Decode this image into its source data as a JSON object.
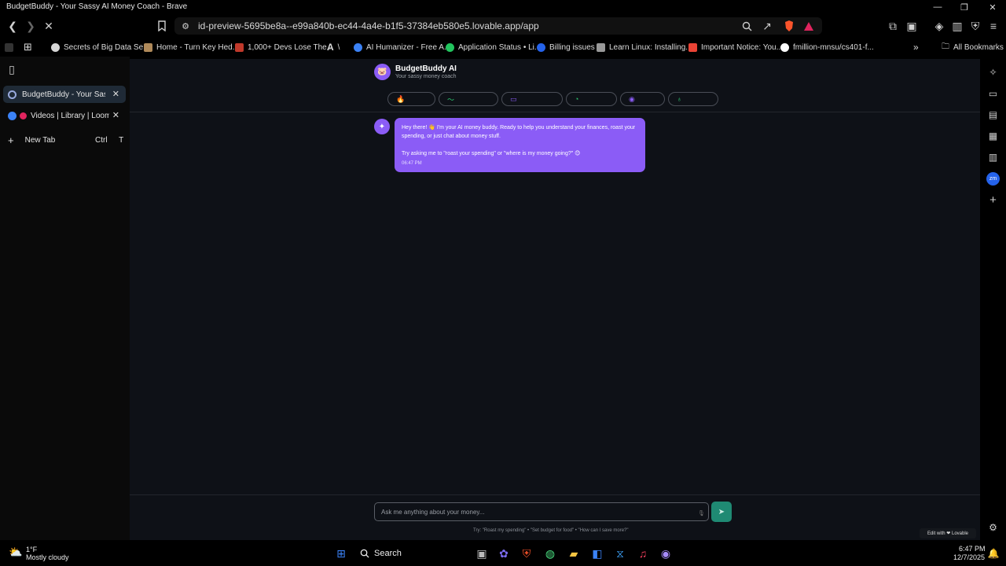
{
  "window": {
    "title": "BudgetBuddy - Your Sassy AI Money Coach - Brave"
  },
  "toolbar": {
    "url": "id-preview-5695be8a--e99a840b-ec44-4a4e-b1f5-37384eb580e5.lovable.app/app"
  },
  "bookmarks": {
    "items": [
      {
        "label": "Secrets of Big Data Se...",
        "icon": "globe-icon",
        "color": "#d6d6d6"
      },
      {
        "label": "Home - Turn Key Hed...",
        "icon": "site-icon",
        "color": "#b08a5a"
      },
      {
        "label": "1,000+ Devs Lose The...",
        "icon": "site-icon",
        "color": "#c0392b"
      },
      {
        "label": "\\",
        "icon": "a-icon",
        "color": "#ffffff"
      },
      {
        "label": "AI Humanizer - Free A...",
        "icon": "site-icon",
        "color": "#3b82f6"
      },
      {
        "label": "Application Status • Li...",
        "icon": "site-icon",
        "color": "#22c55e"
      },
      {
        "label": "Billing issues",
        "icon": "site-icon",
        "color": "#2563eb"
      },
      {
        "label": "Learn Linux: Installing...",
        "icon": "site-icon",
        "color": "#999999"
      },
      {
        "label": "Important Notice: You...",
        "icon": "gmail-icon",
        "color": "#ea4335"
      },
      {
        "label": "fmillion-mnsu/cs401-f...",
        "icon": "github-icon",
        "color": "#ffffff"
      }
    ],
    "all_label": "All Bookmarks"
  },
  "sidebar": {
    "tabs": [
      {
        "label": "BudgetBuddy - Your Sassy AI",
        "active": true
      },
      {
        "label": "Videos | Library | Loom",
        "active": false
      }
    ],
    "new_tab": {
      "label": "New Tab",
      "shortcut": "Ctrl T"
    }
  },
  "app": {
    "brand_name": "BudgetBuddy AI",
    "brand_sub": "Your sassy money coach",
    "chips": [
      {
        "icon": "flame-icon",
        "color": "#e74c3c"
      },
      {
        "icon": "trend-icon",
        "color": "#2ecc71"
      },
      {
        "icon": "card-icon",
        "color": "#8b5cf6"
      },
      {
        "icon": "piggy-icon",
        "color": "#2ecc71"
      },
      {
        "icon": "target-icon",
        "color": "#8b5cf6"
      },
      {
        "icon": "bulb-icon",
        "color": "#2ecc71"
      }
    ],
    "message": {
      "line1": "Hey there! 👋 I'm your AI money buddy. Ready to help you understand your finances, roast your spending, or just chat about money stuff.",
      "line2": "Try asking me to \"roast your spending\" or \"where is my money going?\" 😊",
      "time": "06:47 PM"
    },
    "input_placeholder": "Ask me anything about your money...",
    "hint": "Try: \"Roast my spending\" • \"Set budget for food\" • \"How can I save more?\"",
    "badge": "Edit with ❤ Lovable"
  },
  "taskbar": {
    "weather_temp": "1°F",
    "weather_cond": "Mostly cloudy",
    "search_label": "Search",
    "time": "6:47 PM",
    "date": "12/7/2025"
  }
}
